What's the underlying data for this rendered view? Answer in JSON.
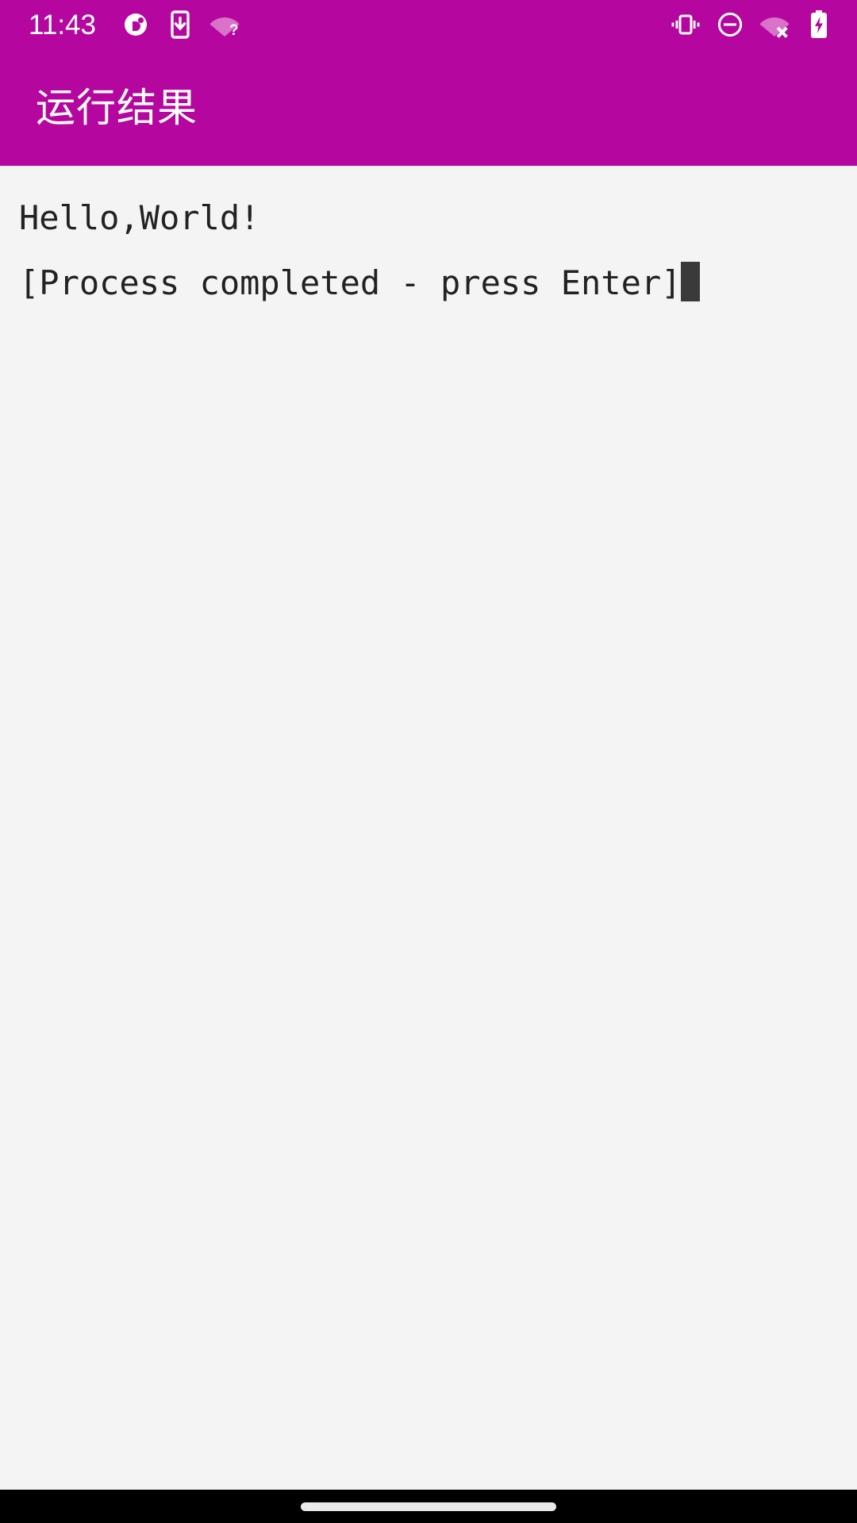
{
  "status_bar": {
    "time": "11:43",
    "left_icons": [
      {
        "name": "app-notification-icon",
        "glyph": "circle-badge"
      },
      {
        "name": "phone-download-icon",
        "glyph": "phone-arrow-down"
      },
      {
        "name": "wifi-unknown-icon",
        "glyph": "wifi-question"
      }
    ],
    "right_icons": [
      {
        "name": "vibrate-icon",
        "glyph": "vibrate"
      },
      {
        "name": "do-not-disturb-icon",
        "glyph": "minus-circle"
      },
      {
        "name": "wifi-disconnected-icon",
        "glyph": "wifi-x"
      },
      {
        "name": "battery-charging-icon",
        "glyph": "battery-bolt"
      }
    ]
  },
  "app_bar": {
    "title": "运行结果"
  },
  "console": {
    "lines": [
      "Hello,World!",
      "[Process completed - press Enter]"
    ],
    "cursor_visible": true
  },
  "navigation_bar": {
    "gesture_pill": "home-gesture-handle"
  },
  "colors": {
    "app_bar": "#b5079f",
    "console_background": "#f4f4f4",
    "console_text": "#222222",
    "cursor": "#3a3a3a",
    "nav_bar": "#000000",
    "status_icon": "#ffffff"
  }
}
